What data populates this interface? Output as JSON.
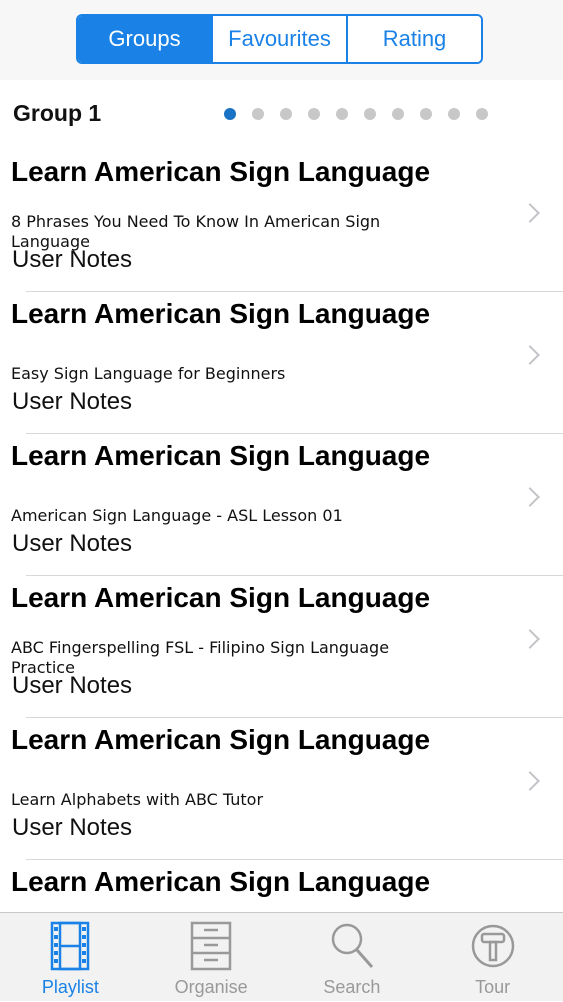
{
  "segments": {
    "groups": "Groups",
    "favourites": "Favourites",
    "rating": "Rating",
    "selected": "Groups"
  },
  "group": {
    "title": "Group 1",
    "page_count": 10,
    "current_page": 1
  },
  "items": [
    {
      "title": "Learn American Sign Language",
      "subtitle": "8 Phrases You Need To Know In American Sign Language",
      "notes": "User Notes"
    },
    {
      "title": "Learn American Sign Language",
      "subtitle": "Easy Sign Language for Beginners",
      "notes": "User Notes"
    },
    {
      "title": "Learn American Sign Language",
      "subtitle": "American Sign Language - ASL Lesson 01",
      "notes": "User Notes"
    },
    {
      "title": "Learn American Sign Language",
      "subtitle": "ABC Fingerspelling FSL - Filipino Sign Language Practice",
      "notes": "User Notes"
    },
    {
      "title": "Learn American Sign Language",
      "subtitle": "Learn Alphabets with ABC Tutor",
      "notes": "User Notes"
    },
    {
      "title": "Learn American Sign Language"
    }
  ],
  "tabbar": {
    "playlist": "Playlist",
    "organise": "Organise",
    "search": "Search",
    "tour": "Tour",
    "selected": "Playlist"
  },
  "colors": {
    "accent": "#1a82e6",
    "inactive": "#999999",
    "separator": "#d8d8d8"
  },
  "icons": {
    "playlist": "film-strip-icon",
    "organise": "cabinet-icon",
    "search": "magnifier-icon",
    "tour": "hammer-icon",
    "row": "chevron-right-icon"
  }
}
